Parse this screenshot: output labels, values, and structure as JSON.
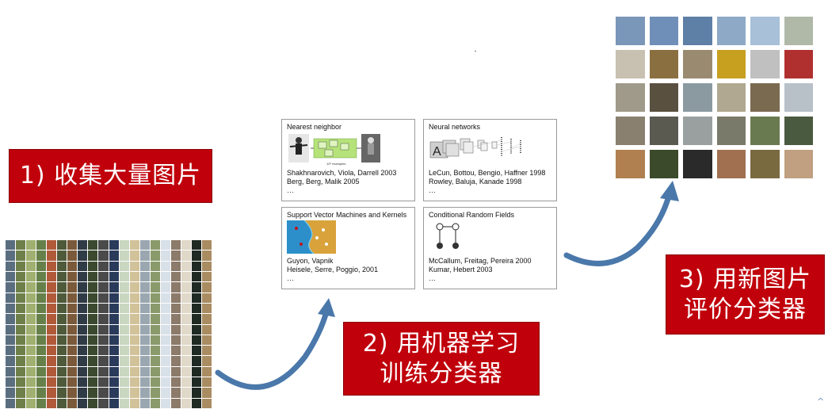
{
  "steps": {
    "step1": {
      "label": "1) 收集大量图片"
    },
    "step2": {
      "line1": "2) 用机器学习",
      "line2": "训练分类器"
    },
    "step3": {
      "line1": "3) 用新图片",
      "line2": "评价分类器"
    }
  },
  "panels": {
    "nn": {
      "title": "Nearest neighbor",
      "caption": "10⁶ examples",
      "refs": [
        "Shakhnarovich, Viola, Darrell 2003",
        "Berg, Berg, Malik 2005",
        "…"
      ]
    },
    "neural": {
      "title": "Neural networks",
      "refs": [
        "LeCun, Bottou, Bengio, Haffner 1998",
        "Rowley, Baluja, Kanade 1998",
        "…"
      ]
    },
    "svm": {
      "title": "Support Vector Machines and Kernels",
      "refs": [
        "Guyon, Vapnik",
        "Heisele, Serre, Poggio, 2001",
        "…"
      ]
    },
    "crf": {
      "title": "Conditional Random Fields",
      "refs": [
        "McCallum, Freitag, Pereira 2000",
        "Kumar, Hebert 2003",
        "…"
      ]
    }
  },
  "colors": {
    "label_bg": "#c0000b",
    "label_text": "#ffffff",
    "arrow": "#4a78aa"
  },
  "icons": {
    "arrow": "curved-arrow-icon",
    "scroll": "chevron-up-icon"
  }
}
